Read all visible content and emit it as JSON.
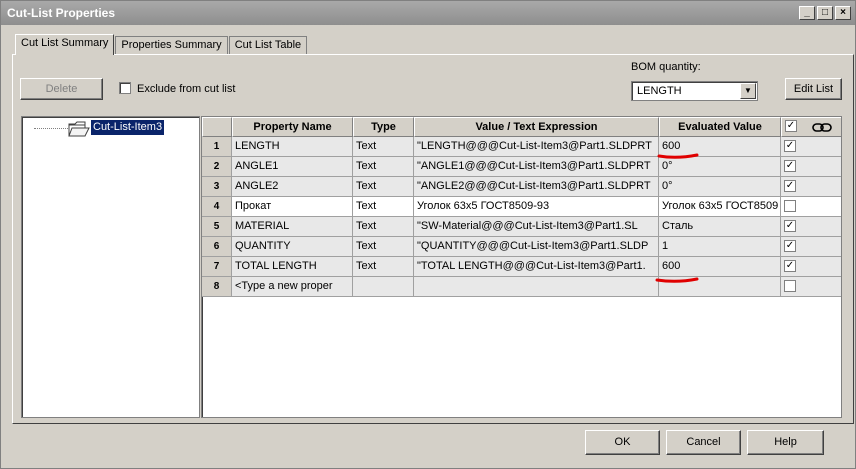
{
  "window": {
    "title": "Cut-List Properties"
  },
  "tabs": [
    "Cut List Summary",
    "Properties Summary",
    "Cut List Table"
  ],
  "toolbar": {
    "delete_label": "Delete",
    "exclude_label": "Exclude from cut list",
    "bom_label": "BOM quantity:",
    "bom_value": "LENGTH",
    "edit_list_label": "Edit List"
  },
  "tree": {
    "item": "Cut-List-Item3"
  },
  "grid": {
    "headers": [
      "Property Name",
      "Type",
      "Value / Text Expression",
      "Evaluated Value"
    ],
    "rows": [
      {
        "num": "1",
        "name": "LENGTH",
        "type": "Text",
        "expr": "\"LENGTH@@@Cut-List-Item3@Part1.SLDPRT",
        "value": "600",
        "checked": true
      },
      {
        "num": "2",
        "name": "ANGLE1",
        "type": "Text",
        "expr": "\"ANGLE1@@@Cut-List-Item3@Part1.SLDPRT",
        "value": "0°",
        "checked": true
      },
      {
        "num": "3",
        "name": "ANGLE2",
        "type": "Text",
        "expr": "\"ANGLE2@@@Cut-List-Item3@Part1.SLDPRT",
        "value": "0°",
        "checked": true
      },
      {
        "num": "4",
        "name": "Прокат",
        "type": "Text",
        "expr": "Уголок 63x5 ГОСТ8509-93",
        "value": "Уголок 63x5 ГОСТ8509",
        "checked": false
      },
      {
        "num": "5",
        "name": "MATERIAL",
        "type": "Text",
        "expr": "\"SW-Material@@@Cut-List-Item3@Part1.SL",
        "value": "Сталь",
        "checked": true
      },
      {
        "num": "6",
        "name": "QUANTITY",
        "type": "Text",
        "expr": "\"QUANTITY@@@Cut-List-Item3@Part1.SLDP",
        "value": "1",
        "checked": true
      },
      {
        "num": "7",
        "name": "TOTAL LENGTH",
        "type": "Text",
        "expr": "\"TOTAL LENGTH@@@Cut-List-Item3@Part1.",
        "value": "600",
        "checked": true
      },
      {
        "num": "8",
        "name": "<Type a new proper",
        "type": "",
        "expr": "",
        "value": "",
        "checked": false
      }
    ]
  },
  "footer": {
    "ok_label": "OK",
    "cancel_label": "Cancel",
    "help_label": "Help"
  },
  "colors": {
    "selection": "#0a246a",
    "annotation_red": "#e00000"
  },
  "icons": [
    "folder-icon",
    "link-icon",
    "check-icon",
    "close-icon",
    "minimize-icon",
    "maximize-icon"
  ]
}
